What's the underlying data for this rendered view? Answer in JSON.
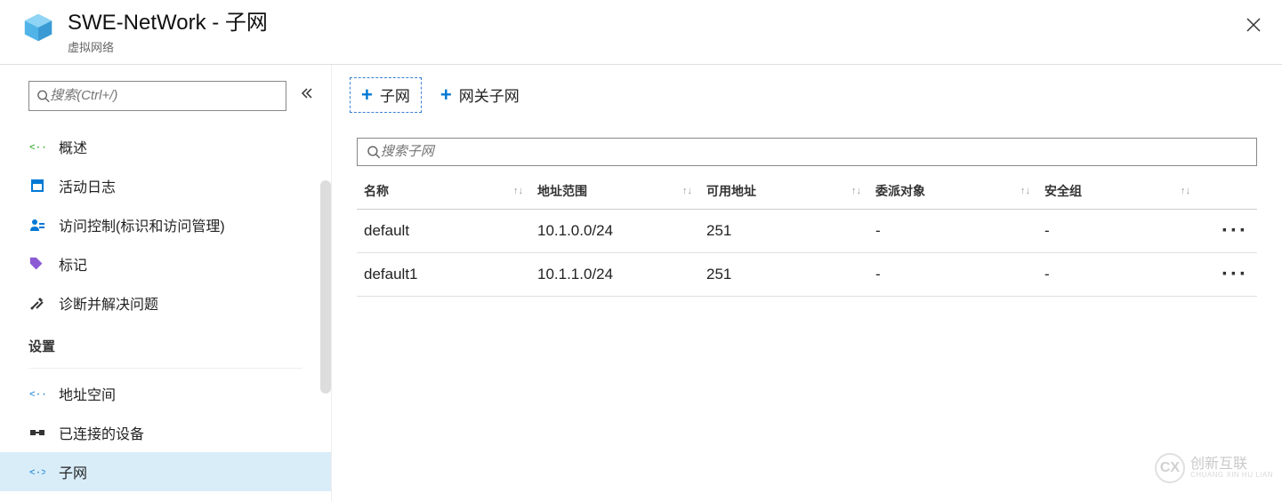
{
  "header": {
    "title": "SWE-NetWork - 子网",
    "subtitle": "虚拟网络"
  },
  "sidebar": {
    "search_placeholder": "搜索(Ctrl+/)",
    "items": [
      {
        "label": "概述"
      },
      {
        "label": "活动日志"
      },
      {
        "label": "访问控制(标识和访问管理)"
      },
      {
        "label": "标记"
      },
      {
        "label": "诊断并解决问题"
      }
    ],
    "section_label": "设置",
    "settings_items": [
      {
        "label": "地址空间"
      },
      {
        "label": "已连接的设备"
      },
      {
        "label": "子网"
      }
    ]
  },
  "toolbar": {
    "add_subnet": "子网",
    "add_gateway_subnet": "网关子网"
  },
  "subnet_search_placeholder": "搜索子网",
  "table": {
    "columns": {
      "name": "名称",
      "range": "地址范围",
      "available": "可用地址",
      "delegate": "委派对象",
      "security": "安全组"
    },
    "rows": [
      {
        "name": "default",
        "range": "10.1.0.0/24",
        "available": "251",
        "delegate": "-",
        "security": "-"
      },
      {
        "name": "default1",
        "range": "10.1.1.0/24",
        "available": "251",
        "delegate": "-",
        "security": "-"
      }
    ]
  },
  "watermark": {
    "cn": "创新互联",
    "en": "CHUANG XIN HU LIAN"
  }
}
